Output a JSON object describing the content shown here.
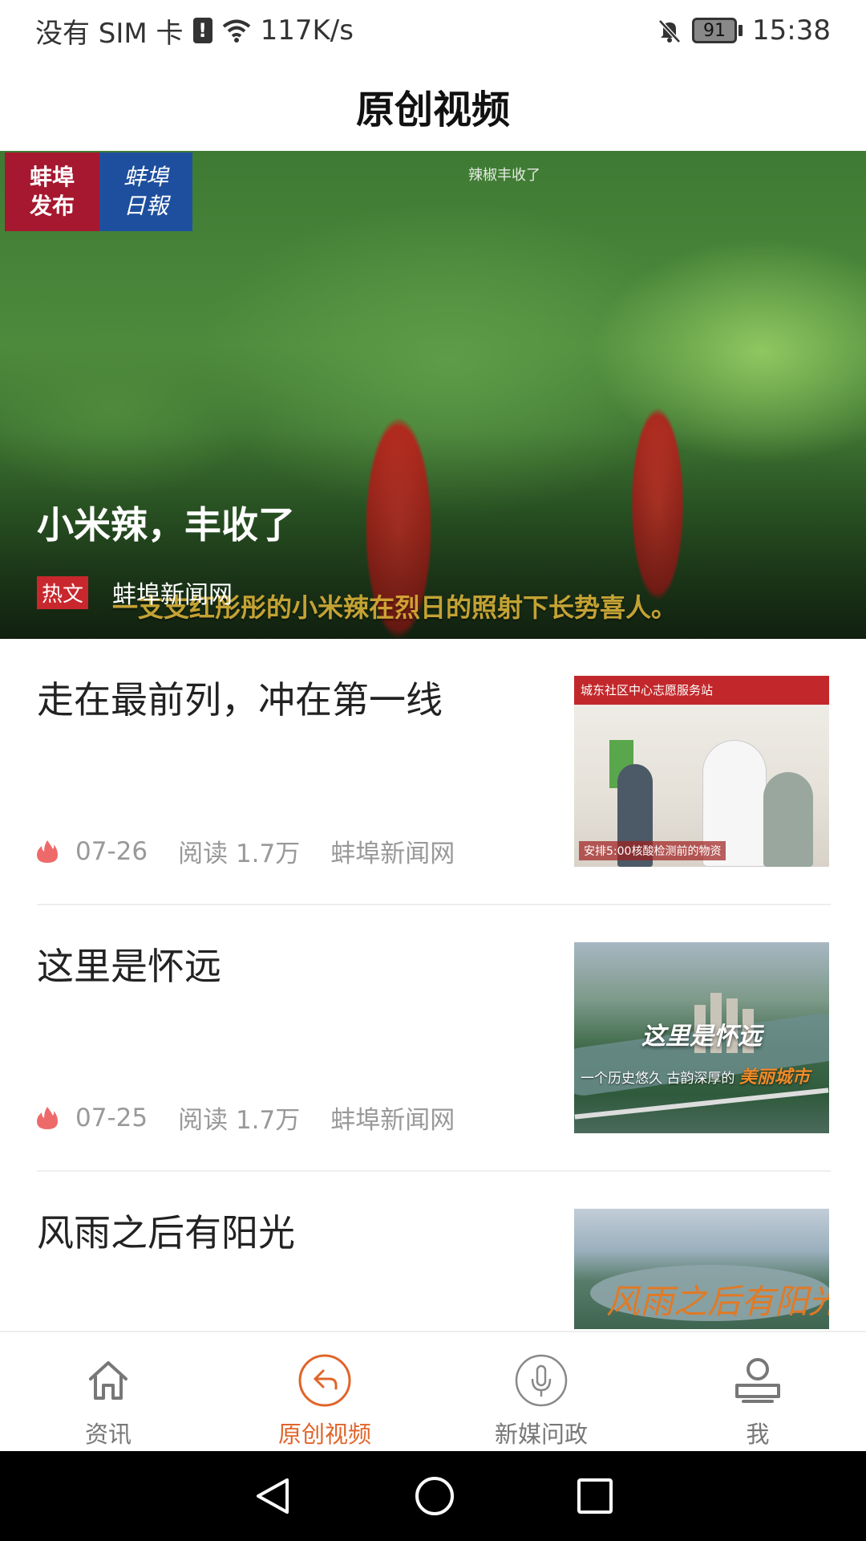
{
  "status_bar": {
    "carrier": "没有 SIM 卡",
    "sim_alert": "!",
    "network_speed": "117K/s",
    "battery": "91",
    "time": "15:38"
  },
  "header": {
    "title": "原创视频"
  },
  "hero": {
    "logo_left_line1": "蚌埠",
    "logo_left_line2": "发布",
    "logo_right_line1": "蚌埠",
    "logo_right_line2": "日報",
    "video_top_caption": "辣椒丰收了",
    "title": "小米辣，丰收了",
    "tag": "热文",
    "source": "蚌埠新闻网",
    "video_subtitle": "一支支红彤彤的小米辣在烈日的照射下长势喜人。"
  },
  "news": [
    {
      "title": "走在最前列，冲在第一线",
      "date": "07-26",
      "reads": "阅读 1.7万",
      "source": "蚌埠新闻网",
      "thumb_banner": "城东社区中心志愿服务站",
      "thumb_caption": "安排5:00核酸检测前的物资"
    },
    {
      "title": "这里是怀远",
      "date": "07-25",
      "reads": "阅读 1.7万",
      "source": "蚌埠新闻网",
      "thumb_title": "这里是怀远",
      "thumb_sub": "一个历史悠久 古韵深厚的",
      "thumb_sub_em": "美丽城市"
    },
    {
      "title": "风雨之后有阳光",
      "thumb_title": "风雨之后有阳光"
    }
  ],
  "bottom_nav": [
    {
      "label": "资讯",
      "icon": "home-icon"
    },
    {
      "label": "原创视频",
      "icon": "video-return-icon"
    },
    {
      "label": "新媒问政",
      "icon": "microphone-icon"
    },
    {
      "label": "我",
      "icon": "user-icon"
    }
  ],
  "colors": {
    "accent": "#e0652a",
    "hot_tag": "#c8272d",
    "meta_text": "#999999",
    "fire": "#ee6a6a"
  }
}
